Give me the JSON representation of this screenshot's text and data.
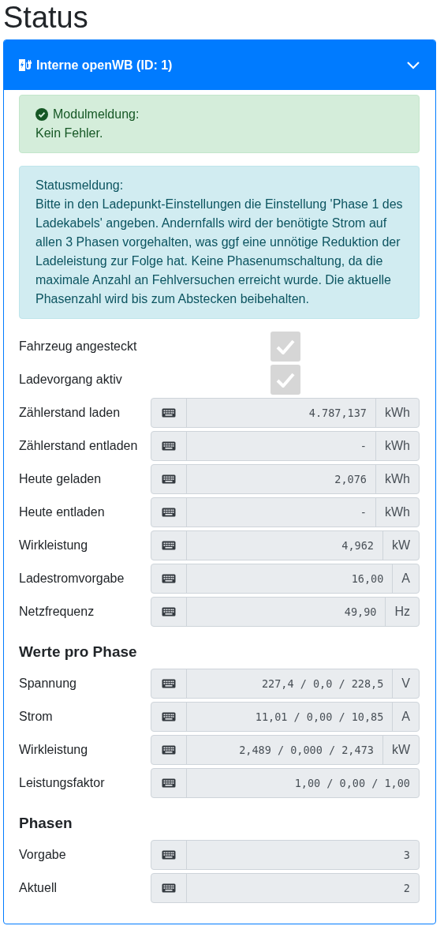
{
  "page_title": "Status",
  "card": {
    "title": "Interne openWB (ID: 1)",
    "expanded": true,
    "alerts": [
      {
        "kind": "success",
        "title": "Modulmeldung:",
        "text": "Kein Fehler."
      },
      {
        "kind": "info",
        "title": "Statusmeldung:",
        "text": "Bitte in den Ladepunkt-Einstellungen die Einstellung 'Phase 1 des Ladekabels' angeben. Andernfalls wird der benötigte Strom auf allen 3 Phasen vorgehalten, was ggf eine unnötige Reduktion der Ladeleistung zur Folge hat. Keine Phasenumschaltung, da die maximale Anzahl an Fehlversuchen erreicht wurde. Die aktuelle Phasenzahl wird bis zum Abstecken beibehalten."
      }
    ],
    "sections": [
      {
        "rows": [
          {
            "kind": "checkbox",
            "label": "Fahrzeug angesteckt",
            "checked": true
          },
          {
            "kind": "checkbox",
            "label": "Ladevorgang aktiv",
            "checked": true
          },
          {
            "kind": "value",
            "label": "Zählerstand laden",
            "value": "4.787,137",
            "unit": "kWh"
          },
          {
            "kind": "value",
            "label": "Zählerstand entladen",
            "value": "-",
            "unit": "kWh"
          },
          {
            "kind": "value",
            "label": "Heute geladen",
            "value": "2,076",
            "unit": "kWh"
          },
          {
            "kind": "value",
            "label": "Heute entladen",
            "value": "-",
            "unit": "kWh"
          },
          {
            "kind": "value",
            "label": "Wirkleistung",
            "value": "4,962",
            "unit": "kW"
          },
          {
            "kind": "value",
            "label": "Ladestromvorgabe",
            "value": "16,00",
            "unit": "A"
          },
          {
            "kind": "value",
            "label": "Netzfrequenz",
            "value": "49,90",
            "unit": "Hz"
          }
        ]
      },
      {
        "heading": "Werte pro Phase",
        "rows": [
          {
            "kind": "value",
            "label": "Spannung",
            "value": "227,4 / 0,0 / 228,5",
            "unit": "V"
          },
          {
            "kind": "value",
            "label": "Strom",
            "value": "11,01 / 0,00 / 10,85",
            "unit": "A"
          },
          {
            "kind": "value",
            "label": "Wirkleistung",
            "value": "2,489 / 0,000 / 2,473",
            "unit": "kW"
          },
          {
            "kind": "value",
            "label": "Leistungsfaktor",
            "value": "1,00 / 0,00 / 1,00"
          }
        ]
      },
      {
        "heading": "Phasen",
        "rows": [
          {
            "kind": "value",
            "label": "Vorgabe",
            "value": "3"
          },
          {
            "kind": "value",
            "label": "Aktuell",
            "value": "2"
          }
        ]
      }
    ]
  }
}
